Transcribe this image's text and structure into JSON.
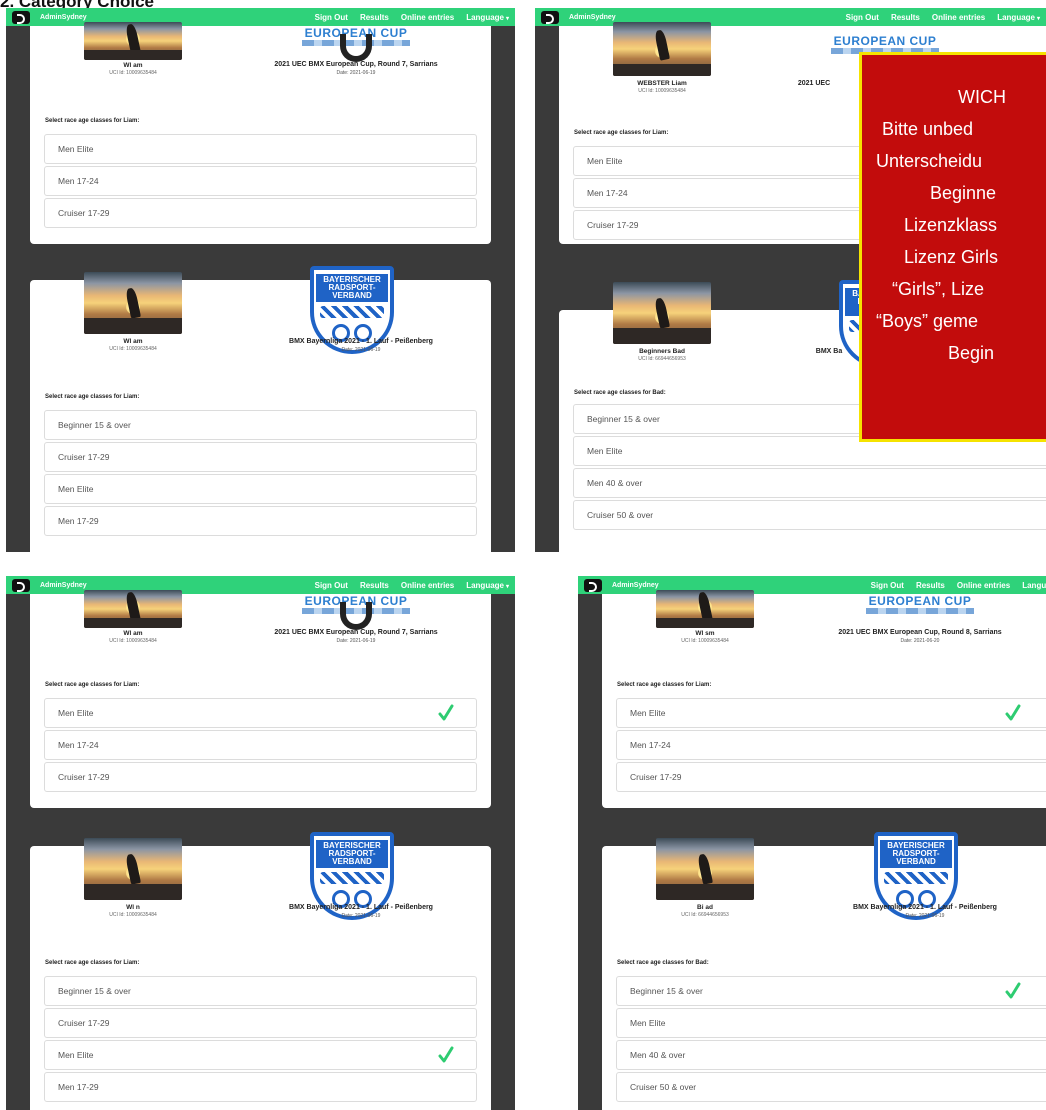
{
  "page_heading": "2. Category Choice",
  "navbar": {
    "brand": "AdminSydney",
    "links": [
      "Sign Out",
      "Results",
      "Online entries",
      "Language"
    ],
    "caret": "▾"
  },
  "select_label_liam": "Select race age classes for Liam:",
  "select_label_bad": "Select race age classes for Bad:",
  "events": {
    "euro_cup_r7": {
      "logo_text": "EUROPEAN CUP",
      "title": "2021 UEC BMX European Cup, Round 7, Sarrians",
      "date": "Date: 2021-06-19"
    },
    "euro_cup_r7_short": {
      "title": "2021 UEC"
    },
    "euro_cup_r8": {
      "logo_text": "EUROPEAN CUP",
      "title": "2021 UEC BMX European Cup, Round 8, Sarrians",
      "date": "Date: 2021-06-20"
    },
    "bayernliga": {
      "logo_lines": [
        "BAYERISCHER",
        "RADSPORT-",
        "VERBAND"
      ],
      "title": "BMX Bayernliga 2021 - 1. Lauf - Peißenberg",
      "date": "Date: 2021-06-19"
    },
    "bayernliga_short": {
      "title": "BMX Ba"
    }
  },
  "riders": {
    "liam_blurred_a": {
      "name": "Wl        am",
      "uci": "UCI Id: 10009635484"
    },
    "liam_blurred_b": {
      "name": "Wl        sm",
      "uci": "UCI Id: 10009635484"
    },
    "liam_blurred_c": {
      "name": "Wl        n",
      "uci": "UCI Id: 10009635484"
    },
    "liam_full": {
      "name": "WEBSTER Liam",
      "uci": "UCI Id: 10009635484"
    },
    "bad_full": {
      "name": "Beginners Bad",
      "uci": "UCI Id: 66944656953"
    },
    "bad_blurred": {
      "name": "Bi        ad",
      "uci": "UCI Id: 66944656953"
    }
  },
  "classes": {
    "euro": [
      "Men Elite",
      "Men 17-24",
      "Cruiser 17-29"
    ],
    "bay_liam": [
      "Beginner 15 & over",
      "Cruiser 17-29",
      "Men Elite",
      "Men 17-29"
    ],
    "bay_bad": [
      "Beginner 15 & over",
      "Men Elite",
      "Men 40 & over",
      "Cruiser 50 & over"
    ]
  },
  "warning": {
    "lines": [
      "WICH",
      "Bitte unbed",
      "Unterscheidu",
      "Beginne",
      "Lizenzklass",
      "Lizenz Girls",
      "“Girls”, Lize",
      "“Boys” geme",
      "Begin"
    ]
  },
  "colors": {
    "navbar": "#2fd27a",
    "check": "#2ecc71",
    "warning_bg": "#c20c0c",
    "warning_border": "#f5e300"
  }
}
